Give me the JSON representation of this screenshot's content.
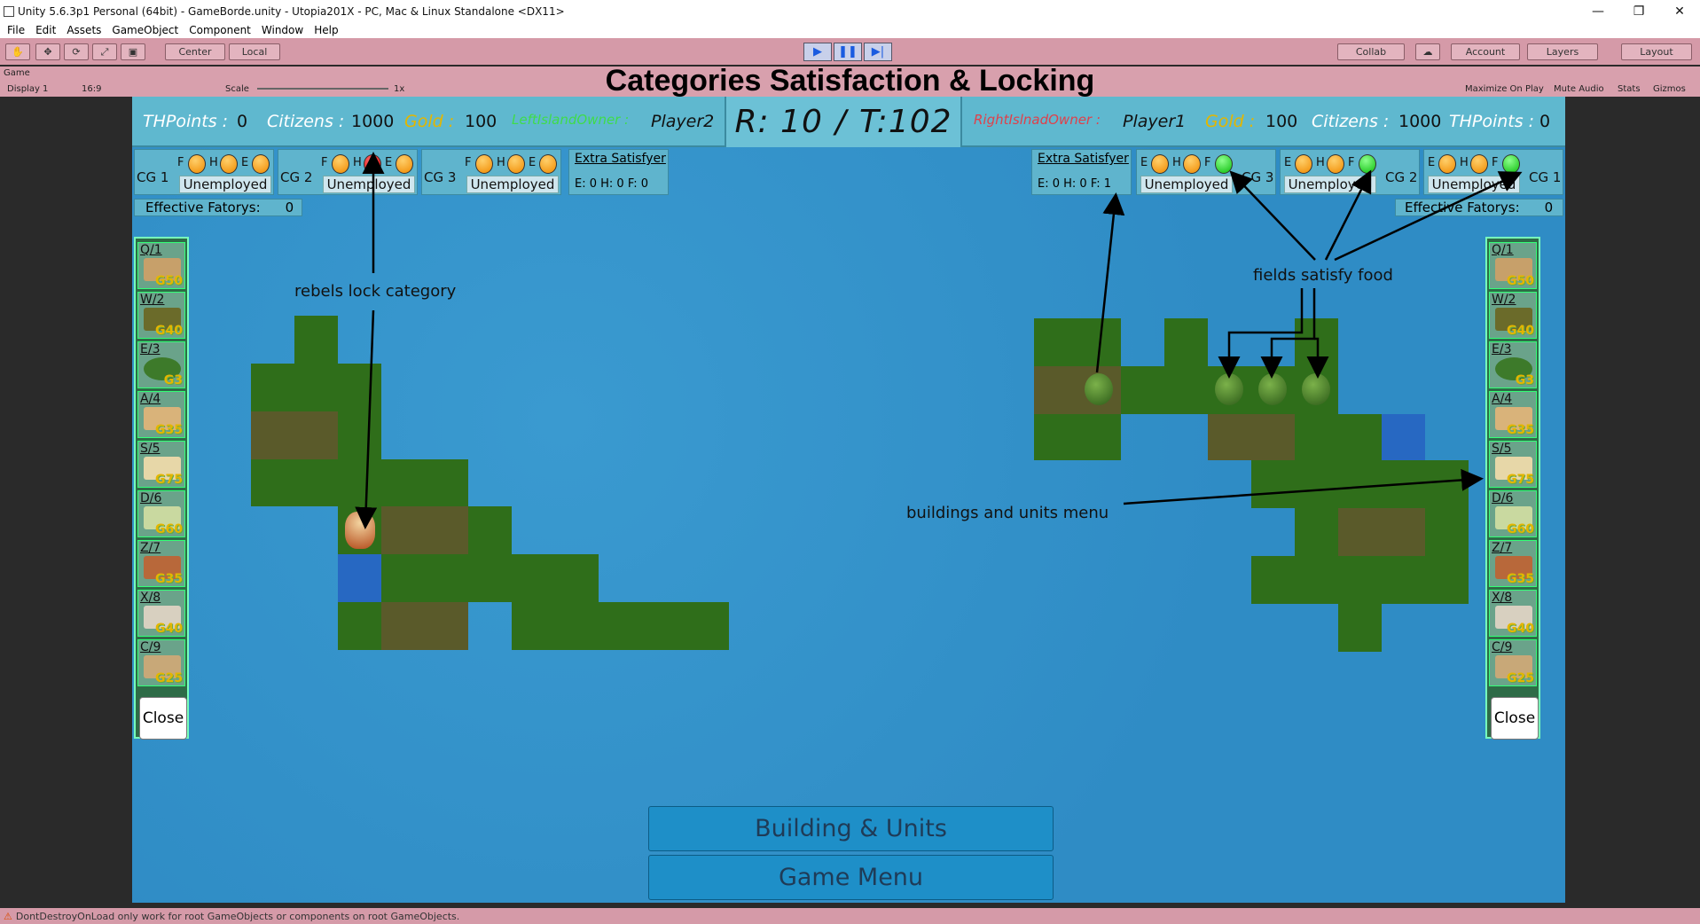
{
  "window": {
    "title": "Unity 5.6.3p1 Personal (64bit) - GameBorde.unity - Utopia201X - PC, Mac & Linux Standalone <DX11>",
    "min": "—",
    "max": "❐",
    "close": "✕"
  },
  "menu": [
    "File",
    "Edit",
    "Assets",
    "GameObject",
    "Component",
    "Window",
    "Help"
  ],
  "toolbar": {
    "center": "Center",
    "local": "Local",
    "collab": "Collab",
    "account": "Account",
    "layers": "Layers",
    "layout": "Layout"
  },
  "gameview": {
    "tab": "Game",
    "display": "Display 1",
    "aspect": "16:9",
    "scale_label": "Scale",
    "scale_value": "1x",
    "maximize": "Maximize On Play",
    "mute": "Mute Audio",
    "stats": "Stats",
    "gizmos": "Gizmos"
  },
  "overlay_title": "Categories Satisfaction & Locking",
  "hud": {
    "left": {
      "thpoints_label": "THPoints :",
      "thpoints": "0",
      "citizens_label": "Citizens :",
      "citizens": "1000",
      "gold_label": "Gold :",
      "gold": "100",
      "owner_label": "LeftIslandOwner :",
      "owner": "Player2"
    },
    "round": "R: 10",
    "sep": "/",
    "turn": "T:102",
    "right": {
      "owner_label": "RightIslnadOwner :",
      "owner": "Player1",
      "gold_label": "Gold :",
      "gold": "100",
      "citizens_label": "Citizens :",
      "citizens": "1000",
      "thpoints_label": "THPoints :",
      "thpoints": "0"
    }
  },
  "categories": {
    "left": [
      {
        "name": "CG 1",
        "status": "Unemployed"
      },
      {
        "name": "CG 2",
        "status": "Unemployed"
      },
      {
        "name": "CG 3",
        "status": "Unemployed"
      }
    ],
    "right": [
      {
        "name": "CG 3",
        "status": "Unemployed"
      },
      {
        "name": "CG 2",
        "status": "Unemployed"
      },
      {
        "name": "CG 1",
        "status": "Unemployed"
      }
    ],
    "letters": {
      "f": "F",
      "h": "H",
      "e": "E"
    }
  },
  "extra_satisfyer": {
    "label": "Extra Satisfyer",
    "left": "E: 0  H: 0  F: 0",
    "right": "E: 0  H: 0  F: 1"
  },
  "effective_factories": {
    "label": "Effective Fatorys:",
    "left": "0",
    "right": "0"
  },
  "menu_items": [
    {
      "key": "Q/1",
      "cost": "G50"
    },
    {
      "key": "W/2",
      "cost": "G40"
    },
    {
      "key": "E/3",
      "cost": "G3"
    },
    {
      "key": "A/4",
      "cost": "G35"
    },
    {
      "key": "S/5",
      "cost": "G75"
    },
    {
      "key": "D/6",
      "cost": "G60"
    },
    {
      "key": "Z/7",
      "cost": "G35"
    },
    {
      "key": "X/8",
      "cost": "G40"
    },
    {
      "key": "C/9",
      "cost": "G25"
    }
  ],
  "close_label": "Close",
  "buttons": {
    "building_units": "Building & Units",
    "game_menu": "Game Menu"
  },
  "annotations": {
    "rebels": "rebels lock category",
    "fields": "fields satisfy food",
    "menu": "buildings and units menu"
  },
  "status": "DontDestroyOnLoad only work for root GameObjects or components on root GameObjects.",
  "colors": {
    "accent": "#1a5be0",
    "toolbar": "#d59aa8",
    "hud": "#5fb8cf",
    "sea": "#2e8fc7",
    "left_owner": "#3fdc4a",
    "right_owner": "#e0404a",
    "gold": "#e3b600"
  }
}
